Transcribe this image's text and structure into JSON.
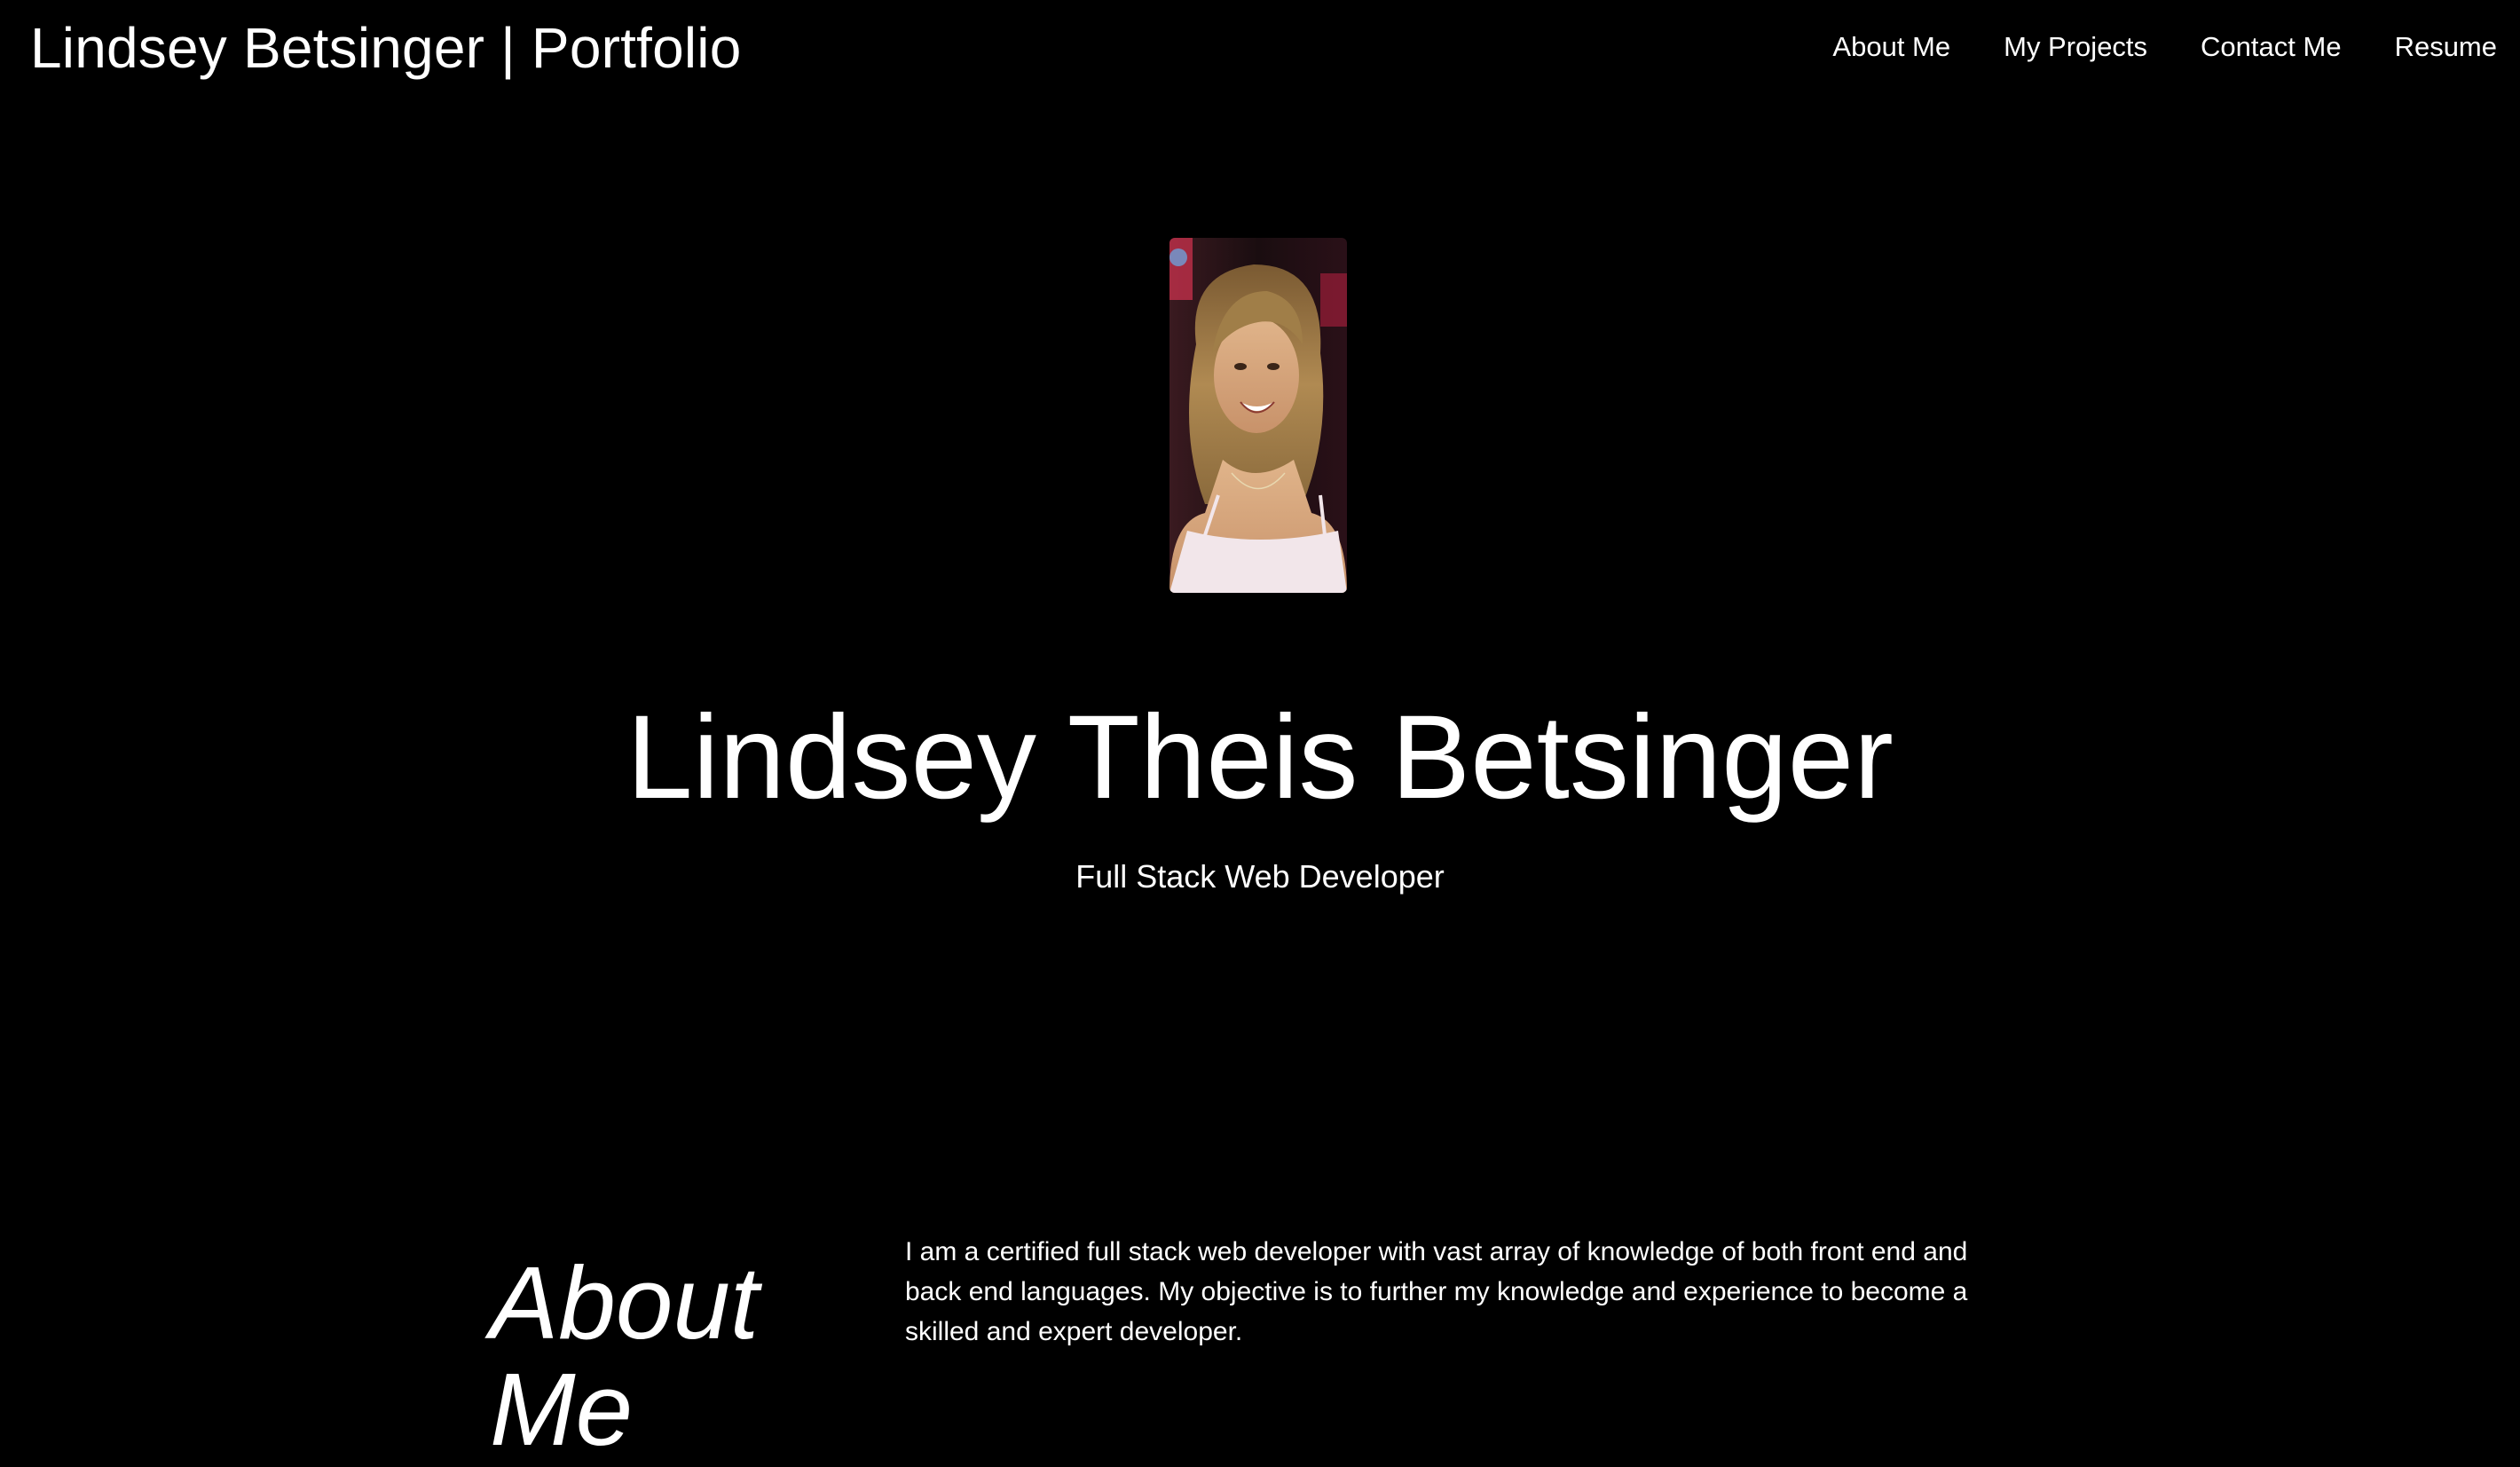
{
  "header": {
    "title": "Lindsey Betsinger | Portfolio",
    "nav": [
      {
        "label": "About Me"
      },
      {
        "label": "My Projects"
      },
      {
        "label": "Contact Me"
      },
      {
        "label": "Resume"
      }
    ]
  },
  "hero": {
    "photo_alt": "profile-photo",
    "name": "Lindsey Theis Betsinger",
    "subtitle": "Full Stack Web Developer"
  },
  "about": {
    "heading": "About Me",
    "body": "I am a certified full stack web developer with vast array of knowledge of both front end and back end languages. My objective is to further my knowledge and experience to become a skilled and expert developer."
  },
  "colors": {
    "background": "#000000",
    "text": "#ffffff"
  }
}
